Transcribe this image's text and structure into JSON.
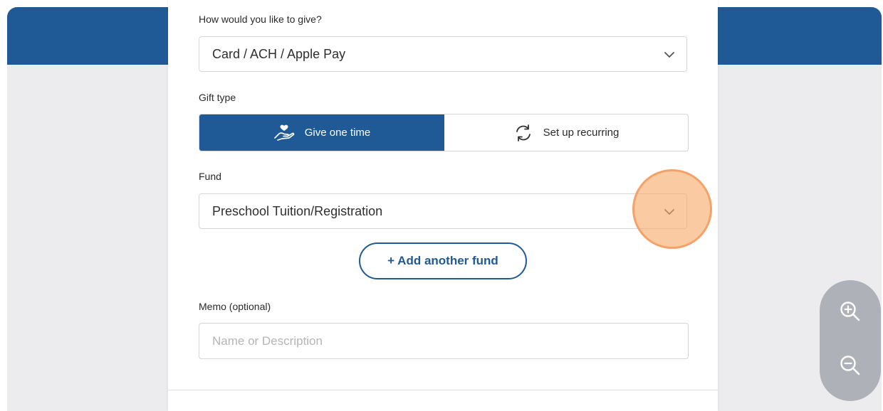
{
  "give_method": {
    "label": "How would you like to give?",
    "selected": "Card / ACH / Apple Pay",
    "chevron_icon": "chevron-down-icon"
  },
  "gift_type": {
    "label": "Gift type",
    "options": [
      {
        "label": "Give one time",
        "icon": "hand-heart-icon",
        "selected": true
      },
      {
        "label": "Set up recurring",
        "icon": "recurring-arrows-icon",
        "selected": false
      }
    ]
  },
  "fund": {
    "label": "Fund",
    "selected": "Preschool Tuition/Registration",
    "chevron_icon": "chevron-down-icon"
  },
  "add_fund_label": "+ Add another fund",
  "memo": {
    "label": "Memo (optional)",
    "placeholder": "Name or Description",
    "value": ""
  },
  "zoom": {
    "in_icon": "zoom-in-icon",
    "out_icon": "zoom-out-icon"
  },
  "colors": {
    "brand_blue": "#1f5a96",
    "page_gray": "#ececee",
    "highlight_orange": "#f3a36a",
    "zoom_panel": "#aeb1b7"
  }
}
